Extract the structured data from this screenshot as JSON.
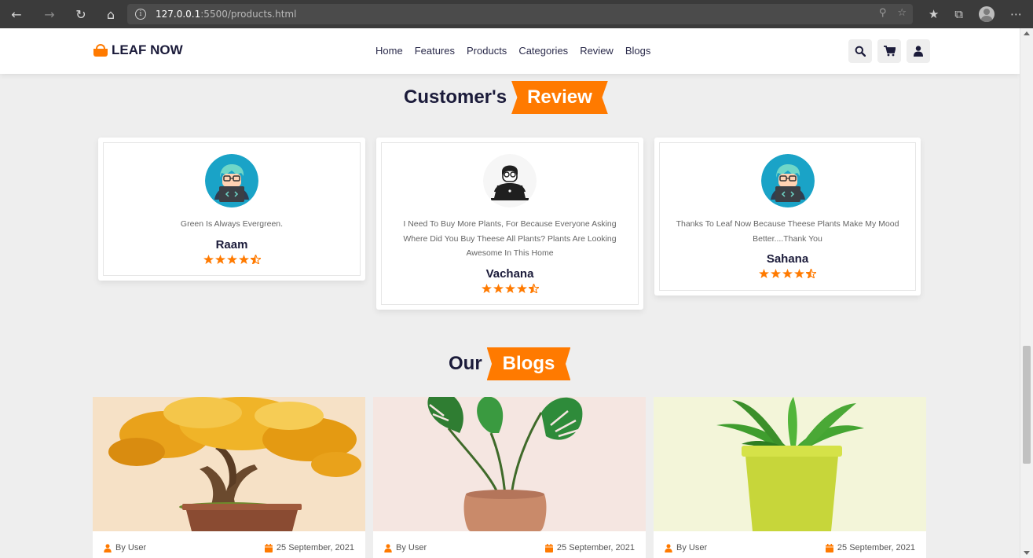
{
  "browser": {
    "url_host": "127.0.0.1",
    "url_rest": ":5500/products.html"
  },
  "site": {
    "logo": "LEAF NOW",
    "nav": [
      "Home",
      "Features",
      "Products",
      "Categories",
      "Review",
      "Blogs"
    ]
  },
  "reviews_section": {
    "title_dark": "Customer's",
    "title_ribbon": "Review",
    "items": [
      {
        "quote": "Green Is Always Evergreen.",
        "name": "Raam",
        "rating": 4.5,
        "avatar": "developer-avatar-icon"
      },
      {
        "quote": "I Need To Buy More Plants, For Because Everyone Asking Where Did You Buy Theese All Plants? Plants Are Looking Awesome In This Home",
        "name": "Vachana",
        "rating": 4.5,
        "avatar": "person-laptop-avatar-icon"
      },
      {
        "quote": "Thanks To Leaf Now Because Theese Plants Make My Mood Better....Thank You",
        "name": "Sahana",
        "rating": 4.5,
        "avatar": "developer-avatar-icon"
      }
    ]
  },
  "blogs_section": {
    "title_dark": "Our",
    "title_ribbon": "Blogs",
    "items": [
      {
        "author": "By User",
        "date": "25 September, 2021",
        "image": "bonsai-tree-image"
      },
      {
        "author": "By User",
        "date": "25 September, 2021",
        "image": "monstera-pot-image"
      },
      {
        "author": "By User",
        "date": "25 September, 2021",
        "image": "green-plant-pot-image"
      }
    ]
  },
  "colors": {
    "accent": "#ff7a00",
    "dark": "#1b1b3a",
    "page_bg": "#eeeeee"
  }
}
